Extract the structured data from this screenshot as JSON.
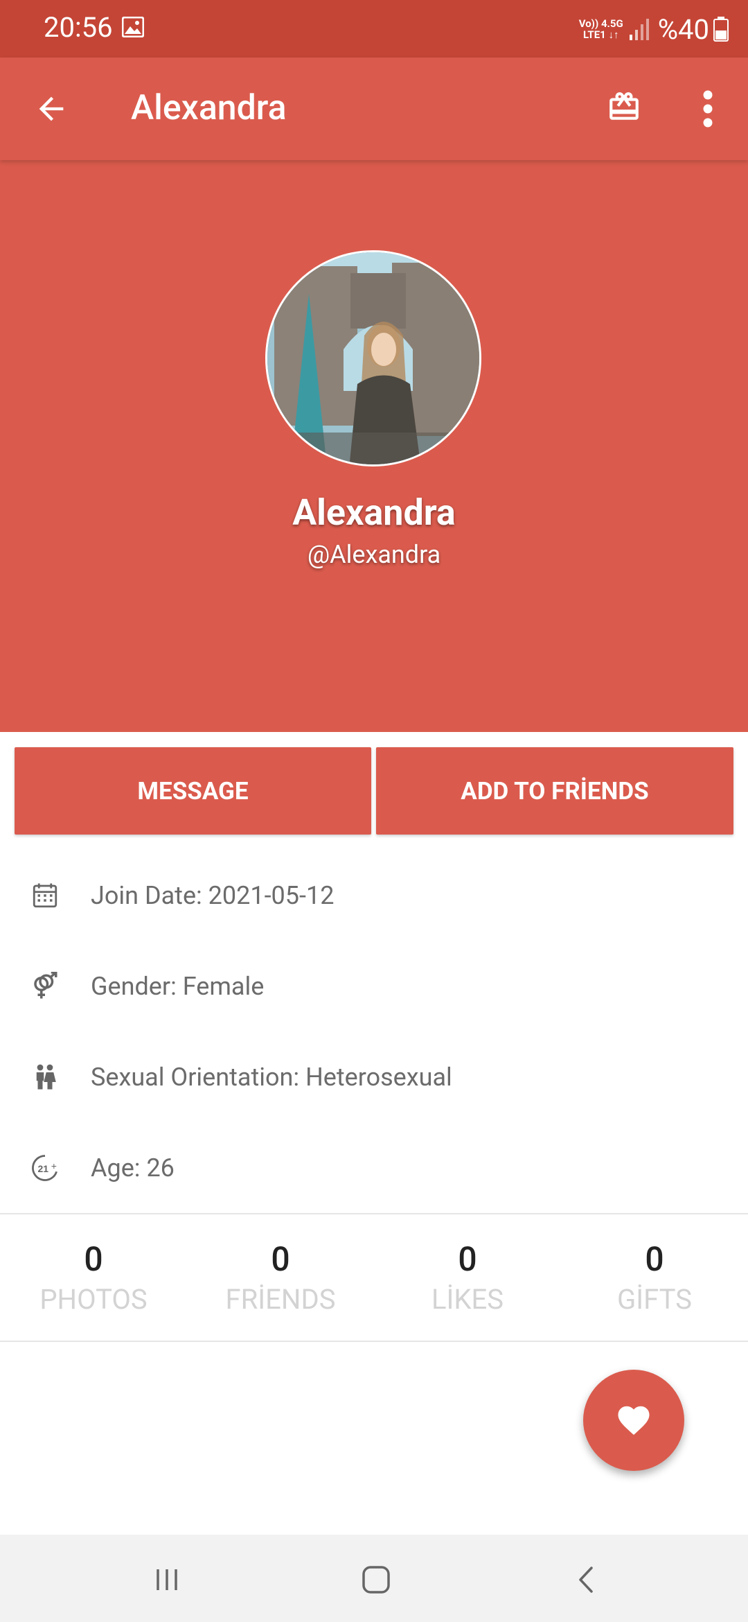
{
  "status_bar": {
    "time": "20:56",
    "network_line1": "Vo)) 4.5G",
    "network_line2": "LTE1 ↓↑",
    "battery": "%40"
  },
  "app_bar": {
    "title": "Alexandra",
    "back_icon": "arrow-back-icon",
    "gift_icon": "gift-icon",
    "more_icon": "more-vert-icon"
  },
  "profile": {
    "name": "Alexandra",
    "username": "@Alexandra"
  },
  "actions": {
    "message_label": "MESSAGE",
    "add_friends_label": "ADD TO FRİENDS"
  },
  "info": {
    "join_date": "Join Date: 2021-05-12",
    "gender": "Gender: Female",
    "orientation": "Sexual Orientation: Heterosexual",
    "age": "Age: 26"
  },
  "stats": [
    {
      "value": "0",
      "label": "PHOTOS"
    },
    {
      "value": "0",
      "label": "FRİENDS"
    },
    {
      "value": "0",
      "label": "LİKES"
    },
    {
      "value": "0",
      "label": "GİFTS"
    }
  ],
  "fab": {
    "icon": "heart-icon"
  },
  "colors": {
    "status_bar": "#c44536",
    "primary": "#da5b4d",
    "text_secondary": "#6b6b6b",
    "stat_label": "#d3d3d3"
  }
}
